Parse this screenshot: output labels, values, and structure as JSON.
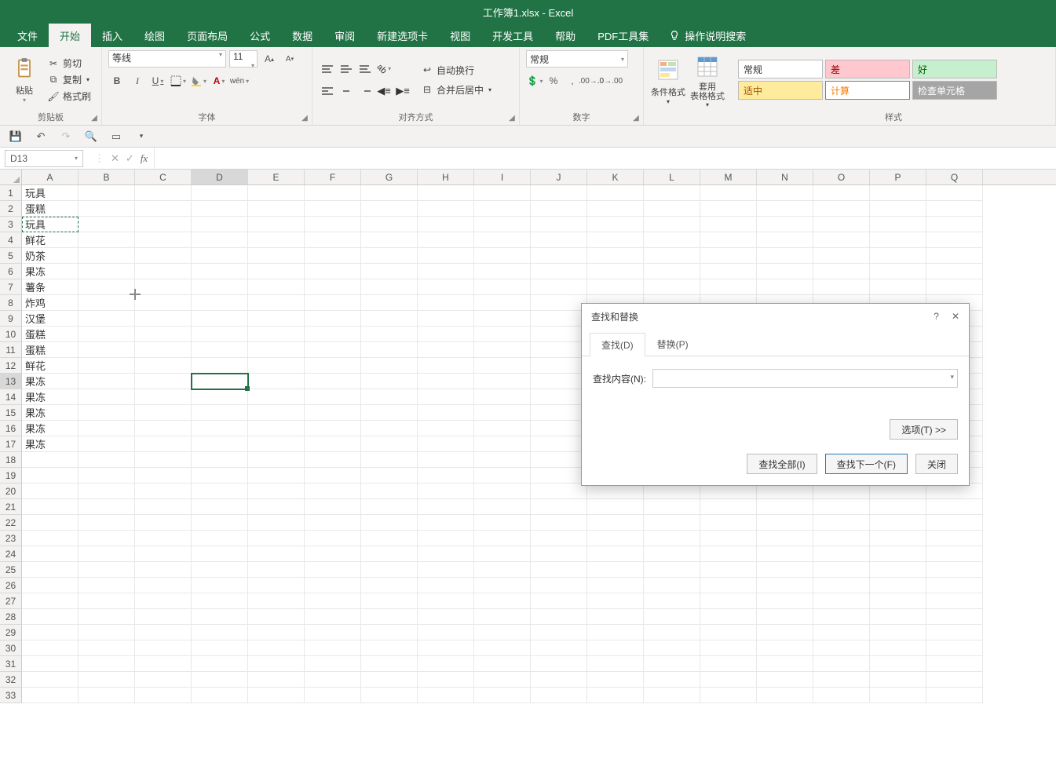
{
  "title": "工作簿1.xlsx - Excel",
  "tabs": [
    "文件",
    "开始",
    "插入",
    "绘图",
    "页面布局",
    "公式",
    "数据",
    "审阅",
    "新建选项卡",
    "视图",
    "开发工具",
    "帮助",
    "PDF工具集"
  ],
  "active_tab": "开始",
  "tell_me": "操作说明搜索",
  "clipboard": {
    "paste": "粘贴",
    "cut": "剪切",
    "copy": "复制",
    "format_painter": "格式刷",
    "group": "剪贴板"
  },
  "font": {
    "name": "等线",
    "size": "11",
    "group": "字体"
  },
  "align": {
    "wrap": "自动换行",
    "merge": "合并后居中",
    "group": "对齐方式"
  },
  "number": {
    "format": "常规",
    "group": "数字"
  },
  "cond": {
    "cond_format": "条件格式",
    "table_format": "套用\n表格格式"
  },
  "styles": {
    "group": "样式",
    "s1": "常规",
    "s2": "差",
    "s3": "好",
    "s4": "适中",
    "s5": "计算",
    "s6": "检查单元格"
  },
  "name_box": "D13",
  "columns": [
    "A",
    "B",
    "C",
    "D",
    "E",
    "F",
    "G",
    "H",
    "I",
    "J",
    "K",
    "L",
    "M",
    "N",
    "O",
    "P",
    "Q"
  ],
  "row_count": 33,
  "active_cell": {
    "row": 13,
    "col": "D"
  },
  "copy_src": {
    "row": 3,
    "col": "A"
  },
  "cells_colA": [
    "玩具",
    "蛋糕",
    "玩具",
    "鲜花",
    "奶茶",
    "果冻",
    "薯条",
    "炸鸡",
    "汉堡",
    "蛋糕",
    "蛋糕",
    "鲜花",
    "果冻",
    "果冻",
    "果冻",
    "果冻",
    "果冻"
  ],
  "dialog": {
    "title": "查找和替换",
    "tab_find": "查找(D)",
    "tab_replace": "替换(P)",
    "find_label": "查找内容(N):",
    "find_value": "",
    "options": "选项(T) >>",
    "find_all": "查找全部(I)",
    "find_next": "查找下一个(F)",
    "close": "关闭",
    "help": "?"
  }
}
